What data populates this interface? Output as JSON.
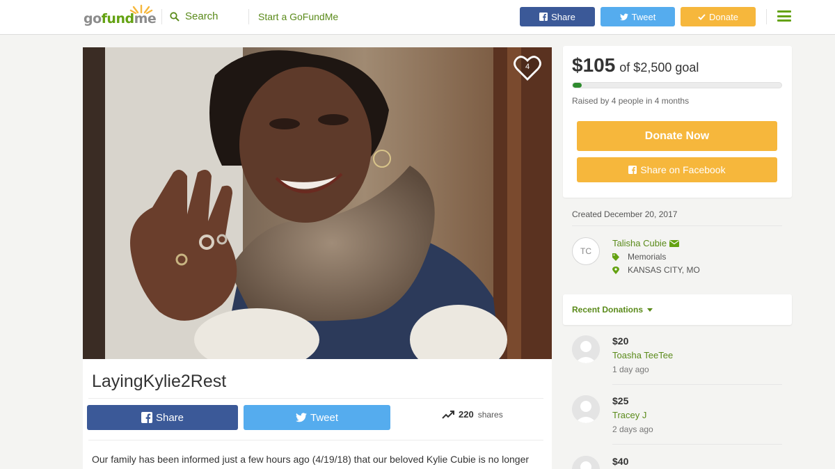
{
  "header": {
    "logo": "gofundme",
    "search_label": "Search",
    "start_label": "Start a GoFundMe",
    "share_label": "Share",
    "tweet_label": "Tweet",
    "donate_label": "Donate"
  },
  "photo": {
    "heart_count": "4"
  },
  "campaign": {
    "title": "LayingKylie2Rest",
    "share_label": "Share",
    "tweet_label": "Tweet",
    "shares_count": "220",
    "shares_label": "shares",
    "story_snippet": "Our family has been informed just a few hours ago (4/19/18) that our beloved Kylie Cubie is no longer"
  },
  "sidebar": {
    "raised_amount": "$105",
    "goal_text": "of $2,500 goal",
    "progress_fraction": 0.042,
    "raised_text": "Raised by 4 people in 4 months",
    "donate_now_label": "Donate Now",
    "share_facebook_label": "Share on Facebook",
    "created": "Created December 20, 2017",
    "organizer": {
      "initials": "TC",
      "name": "Talisha Cubie",
      "category": "Memorials",
      "location": "KANSAS CITY, MO"
    },
    "recent_label": "Recent Donations",
    "donations": [
      {
        "amount": "$20",
        "name": "Toasha TeeTee",
        "time": "1 day ago"
      },
      {
        "amount": "$25",
        "name": "Tracey J",
        "time": "2 days ago"
      },
      {
        "amount": "$40",
        "name": "",
        "time": ""
      }
    ]
  },
  "colors": {
    "brand_green": "#64a212",
    "facebook": "#3b5998",
    "twitter": "#55acee",
    "donate": "#f6b73c"
  }
}
